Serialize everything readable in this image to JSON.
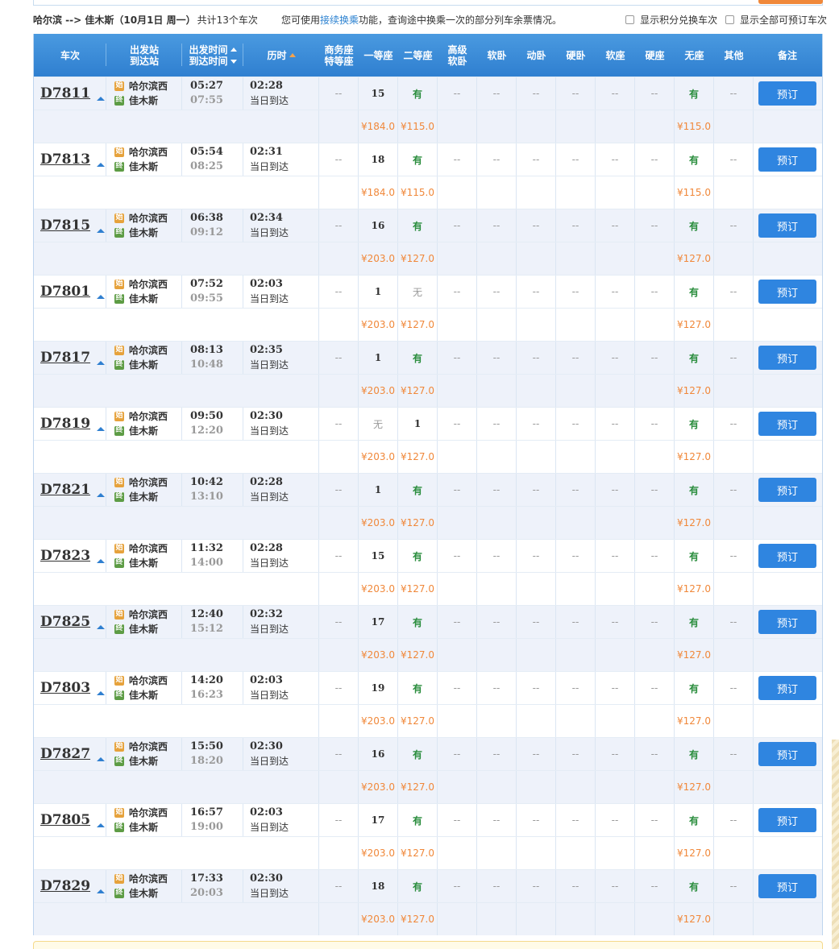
{
  "header": {
    "route": "哈尔滨 --> 佳木斯（10月1日 周一）",
    "count": "共计13个车次",
    "tip_prefix": "您可使用",
    "tip_link": "接续换乘",
    "tip_suffix": "功能，查询途中换乘一次的部分列车余票情况。",
    "opt_points": "显示积分兑换车次",
    "opt_all": "显示全部可预订车次"
  },
  "columns": {
    "train": "车次",
    "station_line1": "出发站",
    "station_line2": "到达站",
    "time_line1": "出发时间",
    "time_line2": "到达时间",
    "duration": "历时",
    "business_line1": "商务座",
    "business_line2": "特等座",
    "first": "一等座",
    "second": "二等座",
    "deluxe_line1": "高级",
    "deluxe_line2": "软卧",
    "soft_sleeper": "软卧",
    "moving_sleeper": "动卧",
    "hard_sleeper": "硬卧",
    "soft_seat": "软座",
    "hard_seat": "硬座",
    "no_seat": "无座",
    "other": "其他",
    "note": "备注"
  },
  "labels": {
    "from": "哈尔滨西",
    "to": "佳木斯",
    "same_day": "当日到达",
    "book": "预订",
    "dash": "--",
    "start_badge": "始",
    "end_badge": "终"
  },
  "trains": [
    {
      "no": "D7811",
      "dep": "05:27",
      "arr": "07:55",
      "dur": "02:28",
      "first": "15",
      "second": "有",
      "noseat": "有",
      "p_first": "¥184.0",
      "p_second": "¥115.0",
      "p_noseat": "¥115.0"
    },
    {
      "no": "D7813",
      "dep": "05:54",
      "arr": "08:25",
      "dur": "02:31",
      "first": "18",
      "second": "有",
      "noseat": "有",
      "p_first": "¥184.0",
      "p_second": "¥115.0",
      "p_noseat": "¥115.0"
    },
    {
      "no": "D7815",
      "dep": "06:38",
      "arr": "09:12",
      "dur": "02:34",
      "first": "16",
      "second": "有",
      "noseat": "有",
      "p_first": "¥203.0",
      "p_second": "¥127.0",
      "p_noseat": "¥127.0"
    },
    {
      "no": "D7801",
      "dep": "07:52",
      "arr": "09:55",
      "dur": "02:03",
      "first": "1",
      "second": "无",
      "noseat": "有",
      "p_first": "¥203.0",
      "p_second": "¥127.0",
      "p_noseat": "¥127.0"
    },
    {
      "no": "D7817",
      "dep": "08:13",
      "arr": "10:48",
      "dur": "02:35",
      "first": "1",
      "second": "有",
      "noseat": "有",
      "p_first": "¥203.0",
      "p_second": "¥127.0",
      "p_noseat": "¥127.0"
    },
    {
      "no": "D7819",
      "dep": "09:50",
      "arr": "12:20",
      "dur": "02:30",
      "first": "无",
      "second": "1",
      "noseat": "有",
      "p_first": "¥203.0",
      "p_second": "¥127.0",
      "p_noseat": "¥127.0"
    },
    {
      "no": "D7821",
      "dep": "10:42",
      "arr": "13:10",
      "dur": "02:28",
      "first": "1",
      "second": "有",
      "noseat": "有",
      "p_first": "¥203.0",
      "p_second": "¥127.0",
      "p_noseat": "¥127.0"
    },
    {
      "no": "D7823",
      "dep": "11:32",
      "arr": "14:00",
      "dur": "02:28",
      "first": "15",
      "second": "有",
      "noseat": "有",
      "p_first": "¥203.0",
      "p_second": "¥127.0",
      "p_noseat": "¥127.0"
    },
    {
      "no": "D7825",
      "dep": "12:40",
      "arr": "15:12",
      "dur": "02:32",
      "first": "17",
      "second": "有",
      "noseat": "有",
      "p_first": "¥203.0",
      "p_second": "¥127.0",
      "p_noseat": "¥127.0"
    },
    {
      "no": "D7803",
      "dep": "14:20",
      "arr": "16:23",
      "dur": "02:03",
      "first": "19",
      "second": "有",
      "noseat": "有",
      "p_first": "¥203.0",
      "p_second": "¥127.0",
      "p_noseat": "¥127.0"
    },
    {
      "no": "D7827",
      "dep": "15:50",
      "arr": "18:20",
      "dur": "02:30",
      "first": "16",
      "second": "有",
      "noseat": "有",
      "p_first": "¥203.0",
      "p_second": "¥127.0",
      "p_noseat": "¥127.0"
    },
    {
      "no": "D7805",
      "dep": "16:57",
      "arr": "19:00",
      "dur": "02:03",
      "first": "17",
      "second": "有",
      "noseat": "有",
      "p_first": "¥203.0",
      "p_second": "¥127.0",
      "p_noseat": "¥127.0"
    },
    {
      "no": "D7829",
      "dep": "17:33",
      "arr": "20:03",
      "dur": "02:30",
      "first": "18",
      "second": "有",
      "noseat": "有",
      "p_first": "¥203.0",
      "p_second": "¥127.0",
      "p_noseat": "¥127.0"
    }
  ],
  "colors": {
    "header_blue": "#2f7fd0",
    "book_blue": "#2f85e0",
    "have_green": "#2a8d3d",
    "price_orange": "#f0883a"
  }
}
